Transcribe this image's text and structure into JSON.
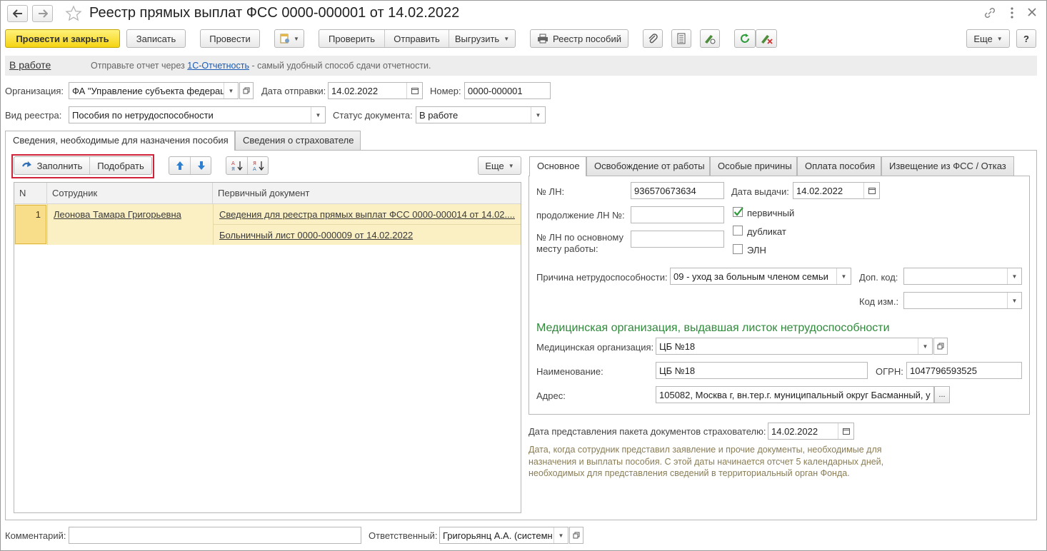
{
  "window": {
    "title": "Реестр прямых выплат ФСС 0000-000001 от 14.02.2022"
  },
  "toolbar": {
    "post_close": "Провести и закрыть",
    "save": "Записать",
    "post": "Провести",
    "check": "Проверить",
    "send": "Отправить",
    "export": "Выгрузить",
    "register_benefits": "Реестр пособий",
    "more": "Еще",
    "help": "?"
  },
  "infobar": {
    "status": "В работе",
    "text_before": "Отправьте отчет через ",
    "link": "1С-Отчетность",
    "text_after": " - самый удобный способ сдачи отчетности."
  },
  "header": {
    "org_label": "Организация:",
    "org_value": "ФА \"Управление субъекта федерац",
    "send_date_label": "Дата отправки:",
    "send_date_value": "14.02.2022",
    "number_label": "Номер:",
    "number_value": "0000-000001",
    "registry_type_label": "Вид реестра:",
    "registry_type_value": "Пособия по нетрудоспособности",
    "doc_status_label": "Статус документа:",
    "doc_status_value": "В работе"
  },
  "tabs": {
    "tab1": "Сведения, необходимые для назначения пособия",
    "tab2": "Сведения о страхователе"
  },
  "left_toolbar": {
    "fill": "Заполнить",
    "pick": "Подобрать",
    "more": "Еще"
  },
  "table": {
    "columns": [
      "N",
      "Сотрудник",
      "Первичный документ"
    ],
    "rows": [
      {
        "n": "1",
        "employee": "Леонова Тамара Григорьевна",
        "doc1": "Сведения для реестра прямых выплат ФСС 0000-000014 от 14.02....",
        "doc2": "Больничный лист 0000-000009 от 14.02.2022"
      }
    ]
  },
  "right_tabs": [
    "Основное",
    "Освобождение от работы",
    "Особые причины",
    "Оплата пособия",
    "Извещение из ФСС / Отказ"
  ],
  "main": {
    "ln_label": "№ ЛН:",
    "ln_value": "936570673634",
    "issue_date_label": "Дата выдачи:",
    "issue_date_value": "14.02.2022",
    "cont_label": "продолжение ЛН №:",
    "cont_value": "",
    "primary_label": "первичный",
    "duplicate_label": "дубликат",
    "eln_label": "ЭЛН",
    "main_job_label_1": "№ ЛН по основному",
    "main_job_label_2": "месту работы:",
    "main_job_value": "",
    "reason_label": "Причина нетрудоспособности:",
    "reason_value": "09 - уход за больным членом семьи",
    "add_code_label": "Доп. код:",
    "add_code_value": "",
    "change_code_label": "Код изм.:",
    "change_code_value": "",
    "med_section_title": "Медицинская организация, выдавшая листок нетрудоспособности",
    "med_org_label": "Медицинская организация:",
    "med_org_value": "ЦБ №18",
    "name_label": "Наименование:",
    "name_value": "ЦБ №18",
    "ogrn_label": "ОГРН:",
    "ogrn_value": "1047796593525",
    "address_label": "Адрес:",
    "address_value": "105082, Москва г, вн.тер.г. муниципальный округ Басманный, у",
    "address_btn": "..."
  },
  "package": {
    "label": "Дата представления пакета документов страхователю:",
    "value": "14.02.2022",
    "hint1": "Дата, когда сотрудник представил заявление и прочие документы, необходимые для",
    "hint2": "назначения и выплаты пособия. С этой даты начинается отсчет 5 календарных дней,",
    "hint3": "необходимых для представления сведений в территориальный орган Фонда."
  },
  "footer": {
    "comment_label": "Комментарий:",
    "comment_value": "",
    "responsible_label": "Ответственный:",
    "responsible_value": "Григорьянц А.А. (системн"
  }
}
